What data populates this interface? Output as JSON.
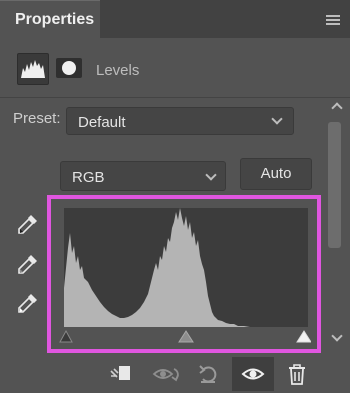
{
  "panel": {
    "tab_label": "Properties",
    "menu_icon": "hamburger-icon"
  },
  "header": {
    "icons": [
      "levels-adjustment-icon",
      "layer-mask-icon"
    ],
    "label": "Levels"
  },
  "preset": {
    "label": "Preset:",
    "value": "Default"
  },
  "channel": {
    "value": "RGB"
  },
  "auto_button": {
    "label": "Auto"
  },
  "eyedroppers": [
    "black-point-eyedropper-icon",
    "gray-point-eyedropper-icon",
    "white-point-eyedropper-icon"
  ],
  "histogram": {
    "highlight_color": "#e056e0",
    "input_sliders": [
      "shadow-slider",
      "midtone-slider",
      "highlight-slider"
    ]
  },
  "footer": {
    "icons": [
      "clip-to-layer-icon",
      "view-previous-state-icon",
      "reset-icon",
      "toggle-visibility-icon",
      "trash-icon"
    ]
  }
}
